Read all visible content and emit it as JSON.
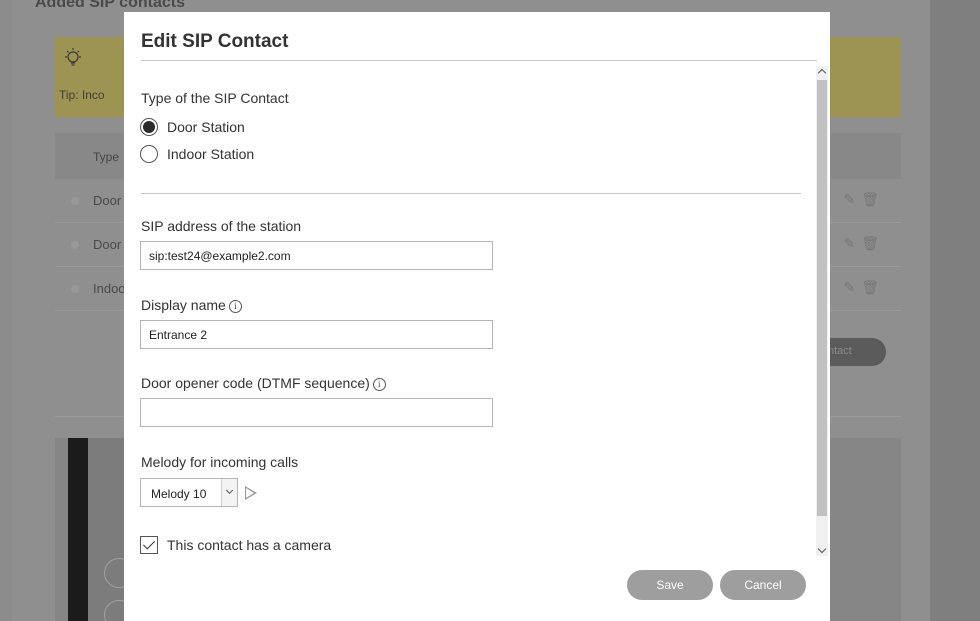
{
  "background": {
    "title": "Added SIP contacts",
    "tip_text": "Tip: Inco",
    "table_header": "Type",
    "rows": [
      {
        "label": "Door"
      },
      {
        "label": "Door"
      },
      {
        "label": "Indoo"
      }
    ],
    "add_button": "ntact"
  },
  "modal": {
    "title": "Edit SIP Contact",
    "type_section": {
      "label": "Type of the SIP Contact",
      "options": [
        {
          "label": "Door Station",
          "checked": true
        },
        {
          "label": "Indoor Station",
          "checked": false
        }
      ]
    },
    "sip_address": {
      "label": "SIP address of the station",
      "value": "sip:test24@example2.com"
    },
    "display_name": {
      "label": "Display name",
      "value": "Entrance 2"
    },
    "door_opener": {
      "label": "Door opener code (DTMF sequence)",
      "value": ""
    },
    "melody": {
      "label": "Melody for incoming calls",
      "selected": "Melody 10"
    },
    "camera": {
      "label": "This contact has a camera",
      "checked": true
    },
    "buttons": {
      "save": "Save",
      "cancel": "Cancel"
    }
  },
  "icons": {
    "tip": "lightbulb-icon",
    "info": "info-icon",
    "play": "play-icon",
    "edit": "pencil-icon",
    "delete": "trash-icon"
  },
  "colors": {
    "overlay": "#8f8f8f",
    "tip_background": "#9d9352",
    "button": "#9e9e9e"
  }
}
